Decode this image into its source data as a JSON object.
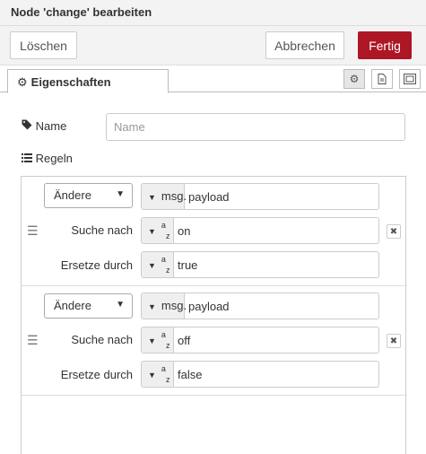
{
  "dialog": {
    "title": "Node 'change' bearbeiten"
  },
  "toolbar": {
    "delete_label": "Löschen",
    "cancel_label": "Abbrechen",
    "done_label": "Fertig"
  },
  "tabs": {
    "properties_label": "Eigenschaften"
  },
  "name_field": {
    "label": "Name",
    "placeholder": "Name",
    "value": ""
  },
  "rules": {
    "label": "Regeln",
    "items": [
      {
        "action": "Ändere",
        "target_type": "msg.",
        "target_value": "payload",
        "search_label": "Suche nach",
        "search_type": "az",
        "search_value": "on",
        "replace_label": "Ersetze durch",
        "replace_type": "az",
        "replace_value": "true"
      },
      {
        "action": "Ändere",
        "target_type": "msg.",
        "target_value": "payload",
        "search_label": "Suche nach",
        "search_type": "az",
        "search_value": "off",
        "replace_label": "Ersetze durch",
        "replace_type": "az",
        "replace_value": "false"
      }
    ]
  },
  "icons": [
    "gear-icon",
    "tag-icon",
    "list-icon",
    "document-icon",
    "layout-icon",
    "drag-handle-icon",
    "close-icon",
    "caret-down-icon"
  ],
  "colors": {
    "primary": "#ad1625",
    "toolbar_bg": "#f3f3f3",
    "type_bg": "#efefef"
  }
}
